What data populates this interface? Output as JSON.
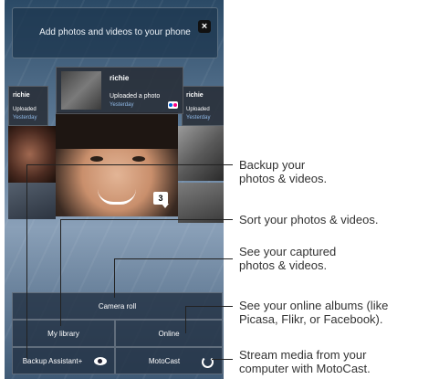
{
  "banner": {
    "text": "Add photos and videos to your phone",
    "close": "×"
  },
  "cards": {
    "main": {
      "name": "richie",
      "action": "Uploaded a photo",
      "when": "Yesterday"
    },
    "left": {
      "name": "richie",
      "action": "Uploaded",
      "when": "Yesterday"
    },
    "right": {
      "name": "richie",
      "action": "Uploaded",
      "when": "Yesterday"
    }
  },
  "count_badge": "3",
  "tiles": {
    "camera": "Camera roll",
    "library": "My library",
    "online": "Online",
    "backup": "Backup Assistant+",
    "motocast": "MotoCast"
  },
  "icons": {
    "close": "close-icon",
    "flickr": "flickr-icon",
    "eye": "eye-icon",
    "refresh": "refresh-icon"
  },
  "callouts": {
    "backup": [
      "Backup your",
      "photos & videos."
    ],
    "sort": [
      "Sort your photos & videos."
    ],
    "captured": [
      "See your captured",
      "photos & videos."
    ],
    "online": [
      "See your online albums (like",
      "Picasa, Flikr, or Facebook)."
    ],
    "stream": [
      "Stream media from your",
      "computer with MotoCast."
    ]
  }
}
